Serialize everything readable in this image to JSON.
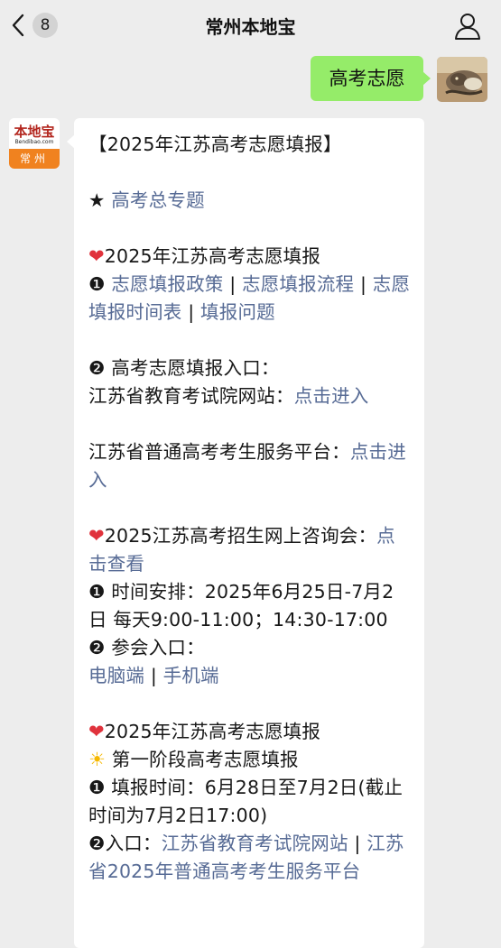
{
  "header": {
    "title": "常州本地宝",
    "badge_count": "8"
  },
  "outgoing": {
    "text": "高考志愿"
  },
  "bot": {
    "logo_main": "本地宝",
    "logo_sub": "Bendibao.com",
    "logo_city": "常州"
  },
  "msg": {
    "title": "【2025年江苏高考志愿填报】",
    "star": "★",
    "topic_link": "高考总专题",
    "heart": "❤",
    "sec1_title": "2025年江苏高考志愿填报",
    "n1": "❶",
    "l_policy": "志愿填报政策",
    "sep": " | ",
    "l_process": "志愿填报流程",
    "l_schedule": "志愿填报时间表",
    "l_issues": "填报问题",
    "n2": "❷",
    "entry_title": "高考志愿填报入口：",
    "exam_site_label": "江苏省教育考试院网站：",
    "click_enter": "点击进入",
    "platform_label": "江苏省普通高考考生服务平台：",
    "sec2_title": "2025江苏高考招生网上咨询会：",
    "click_view": "点击查看",
    "time_label": "时间安排：2025年6月25日-7月2日 每天9:00-11:00；14:30-17:00",
    "join_label": "参会入口：",
    "l_pc": "电脑端",
    "l_mobile": "手机端",
    "sec3_title": "2025年江苏高考志愿填报",
    "sun": "☀",
    "phase1": "第一阶段高考志愿填报",
    "fill_time": "填报时间：6月28日至7月2日(截止时间为7月2日17:00)",
    "entry2": "入口：",
    "l_exam_site": "江苏省教育考试院网站",
    "l_platform": "江苏省2025年普通高考考生服务平台"
  }
}
